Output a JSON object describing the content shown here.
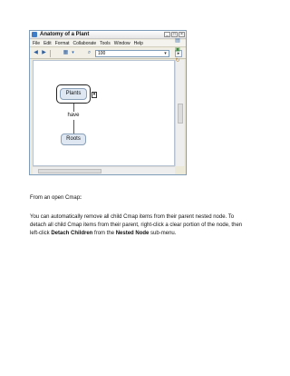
{
  "window": {
    "title": "Anatomy of a Plant",
    "controls": {
      "minimize": "_",
      "maximize": "□",
      "close": "×"
    }
  },
  "menu": [
    "File",
    "Edit",
    "Format",
    "Collaborate",
    "Tools",
    "Window",
    "Help"
  ],
  "toolbar": {
    "zoom_value": "100",
    "icons": [
      "back-arrow-icon",
      "forward-arrow-icon",
      "layout-icon",
      "dropdown-icon",
      "find-icon"
    ]
  },
  "map": {
    "top_concept": "Plants",
    "linking_phrase": "have",
    "bottom_concept": "Roots",
    "nested_toggle": "▾"
  },
  "doc": {
    "heading_text": "From an open Cmap",
    "heading_suffix": ":",
    "line1": "You can automatically remove all child Cmap items from their parent nested node. To",
    "line2": "detach all child Cmap items from their parent, right-click a clear portion of the node, then",
    "line3_prefix": "left-click ",
    "line3_bold1": "Detach Children",
    "line3_mid": " from the ",
    "line3_bold2": "Nested Node",
    "line3_suffix": " sub-menu."
  },
  "colors": {
    "window_border": "#7f9db9",
    "concept_fill": "#dfe8f2",
    "concept_border": "#8a9fb8",
    "toolbar_icon": "#2f5f9e"
  }
}
